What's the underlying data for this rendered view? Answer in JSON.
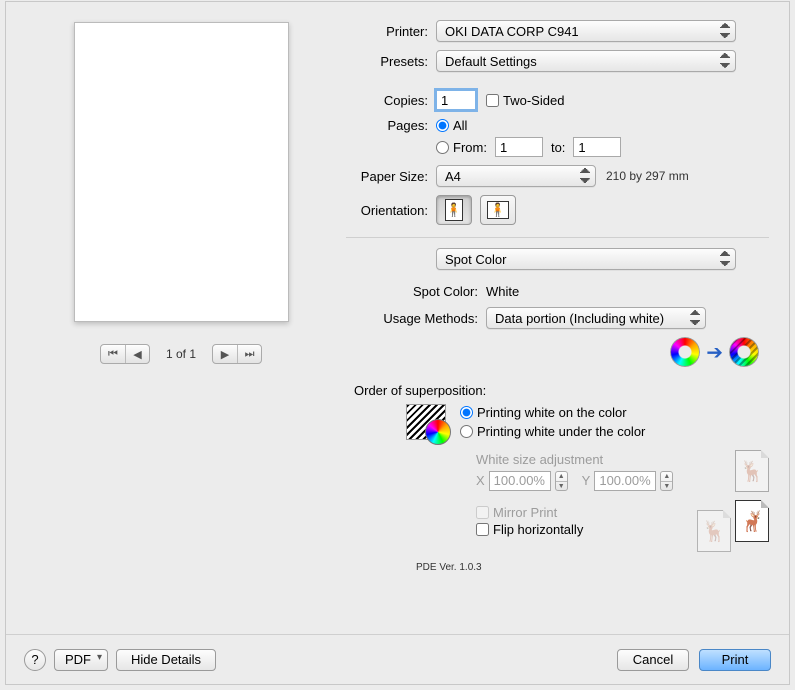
{
  "labels": {
    "printer": "Printer:",
    "presets": "Presets:",
    "copies": "Copies:",
    "two_sided": "Two-Sided",
    "pages": "Pages:",
    "all": "All",
    "from": "From:",
    "to": "to:",
    "paper_size": "Paper Size:",
    "paper_hint": "210 by 297 mm",
    "orientation": "Orientation:",
    "spot_color": "Spot Color:",
    "usage_methods": "Usage Methods:",
    "order": "Order of superposition:",
    "order_a": "Printing white on the color",
    "order_b": "Printing white under the color",
    "white_adj": "White size adjustment",
    "mirror": "Mirror Print",
    "flip": "Flip horizontally"
  },
  "values": {
    "printer": "OKI DATA CORP C941",
    "presets": "Default Settings",
    "copies": "1",
    "pages_from": "1",
    "pages_to": "1",
    "paper_size": "A4",
    "section": "Spot Color",
    "spot_color_value": "White",
    "usage_value": "Data portion (Including white)",
    "adj_x_label": "X",
    "adj_x": "100.00%",
    "adj_y_label": "Y",
    "adj_y": "100.00%"
  },
  "pager": {
    "text": "1 of 1"
  },
  "footer": {
    "pdf": "PDF",
    "hide": "Hide Details",
    "cancel": "Cancel",
    "print": "Print"
  },
  "version": "PDE Ver.  1.0.3"
}
